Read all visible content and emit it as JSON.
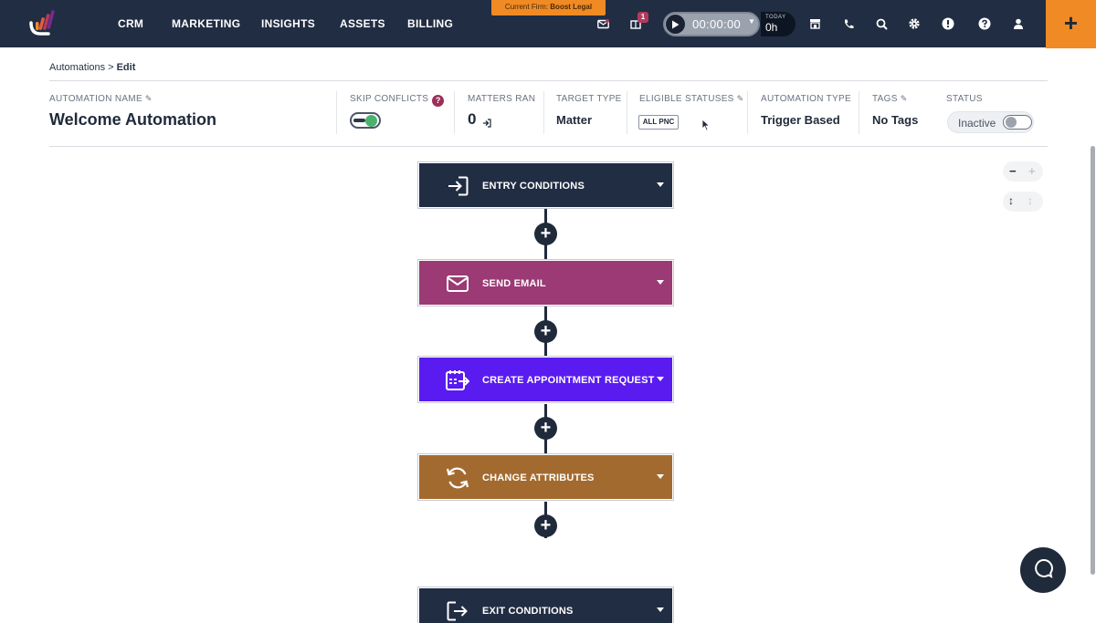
{
  "nav": {
    "items": [
      "CRM",
      "MARKETING",
      "INSIGHTS",
      "ASSETS",
      "BILLING"
    ],
    "firm_banner_prefix": "Current Firm:",
    "firm_banner_name": "Boost Legal",
    "notification_badge": "1",
    "timer_time": "00:00:00",
    "today_label": "TODAY",
    "today_value": "0h",
    "add_label": "+",
    "icons": [
      "mail-icon",
      "notifications-icon",
      "play-icon",
      "store-icon",
      "phone-icon",
      "search-icon",
      "gear-icon",
      "alert-icon",
      "help-icon",
      "user-icon"
    ]
  },
  "breadcrumb": {
    "parent": "Automations",
    "separator": ">",
    "current": "Edit"
  },
  "header": {
    "automation_name_label": "AUTOMATION NAME",
    "automation_name": "Welcome Automation",
    "skip_conflicts_label": "SKIP CONFLICTS",
    "skip_conflicts_help": "?",
    "skip_conflicts_on": true,
    "matters_ran_label": "MATTERS RAN",
    "matters_ran": "0",
    "target_type_label": "TARGET TYPE",
    "target_type": "Matter",
    "eligible_statuses_label": "ELIGIBLE STATUSES",
    "eligible_statuses_chip": "ALL PNC",
    "automation_type_label": "AUTOMATION TYPE",
    "automation_type": "Trigger Based",
    "tags_label": "TAGS",
    "tags": "No Tags",
    "status_label": "STATUS",
    "status": "Inactive",
    "status_active": false
  },
  "workflow": {
    "steps": [
      {
        "label": "ENTRY CONDITIONS",
        "color": "#212d43",
        "icon": "sign-in-icon"
      },
      {
        "label": "SEND EMAIL",
        "color": "#9b3a74",
        "icon": "envelope-icon"
      },
      {
        "label": "CREATE APPOINTMENT REQUEST",
        "color": "#5a1bf0",
        "icon": "calendar-arrow-icon"
      },
      {
        "label": "CHANGE ATTRIBUTES",
        "color": "#a36a2f",
        "icon": "refresh-icon"
      },
      {
        "label": "EXIT CONDITIONS",
        "color": "#212d43",
        "icon": "sign-out-icon"
      }
    ],
    "add_step_label": "+",
    "zoom_out_label": "−",
    "zoom_in_label": "+",
    "fit_label": "↕"
  },
  "colors": {
    "topbar": "#212d43",
    "accent_orange": "#f08a24",
    "toggle_green": "#49b26e",
    "help_magenta": "#9b2f5a"
  }
}
